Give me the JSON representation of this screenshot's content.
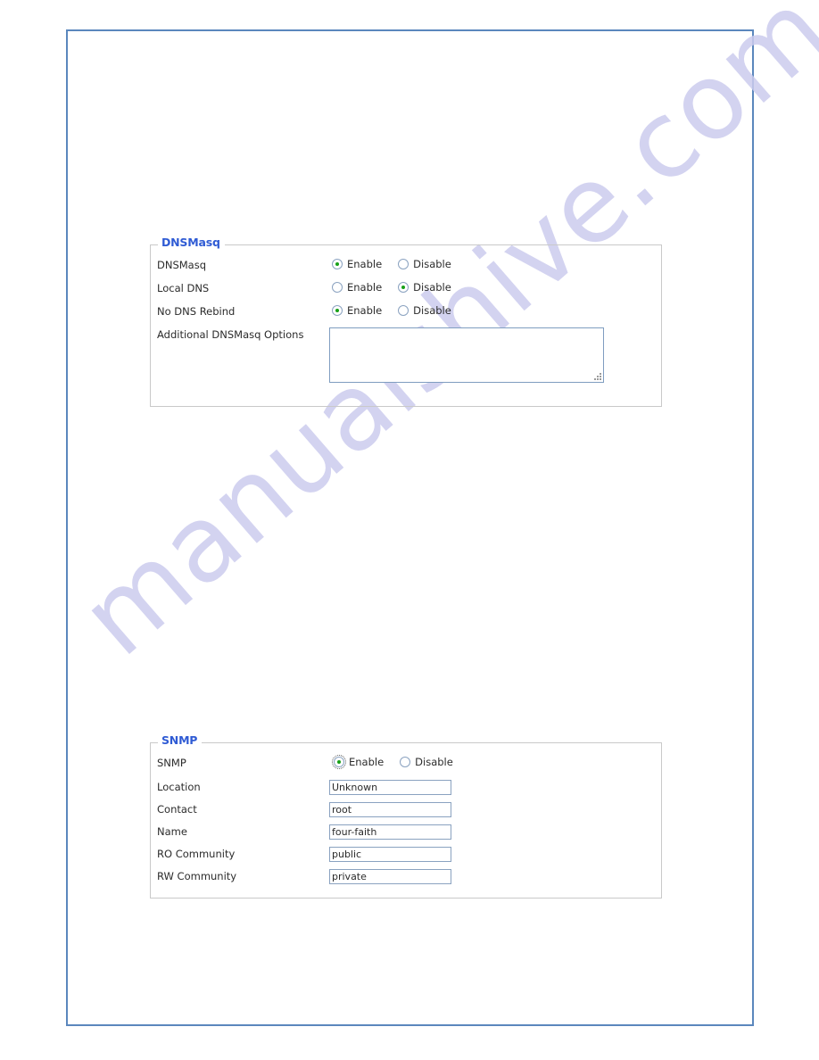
{
  "page": {
    "frame_color": "#5b87bd",
    "background": "#ffffff",
    "watermark": "manualshive.com",
    "watermark_color": "#ccccee"
  },
  "panels": [
    {
      "id": "dnsmasq",
      "legend": "DNSMasq",
      "legend_color": "#2f5bd4",
      "rows": [
        {
          "label": "DNSMasq",
          "type": "radio",
          "options": [
            {
              "label": "Enable",
              "selected": true,
              "focused": false
            },
            {
              "label": "Disable",
              "selected": false,
              "focused": false
            }
          ]
        },
        {
          "label": "Local DNS",
          "type": "radio",
          "options": [
            {
              "label": "Enable",
              "selected": false,
              "focused": false
            },
            {
              "label": "Disable",
              "selected": true,
              "focused": false
            }
          ]
        },
        {
          "label": "No DNS Rebind",
          "type": "radio",
          "options": [
            {
              "label": "Enable",
              "selected": true,
              "focused": false
            },
            {
              "label": "Disable",
              "selected": false,
              "focused": false
            }
          ]
        },
        {
          "label": "Additional DNSMasq Options",
          "type": "textarea",
          "value": ""
        }
      ]
    },
    {
      "id": "snmp",
      "legend": "SNMP",
      "legend_color": "#2f5bd4",
      "rows": [
        {
          "label": "SNMP",
          "type": "radio",
          "options": [
            {
              "label": "Enable",
              "selected": true,
              "focused": true
            },
            {
              "label": "Disable",
              "selected": false,
              "focused": false
            }
          ]
        },
        {
          "label": "Location",
          "type": "text",
          "value": "Unknown"
        },
        {
          "label": "Contact",
          "type": "text",
          "value": "root"
        },
        {
          "label": "Name",
          "type": "text",
          "value": "four-faith"
        },
        {
          "label": "RO Community",
          "type": "text",
          "value": "public"
        },
        {
          "label": "RW Community",
          "type": "text",
          "value": "private"
        }
      ]
    }
  ]
}
